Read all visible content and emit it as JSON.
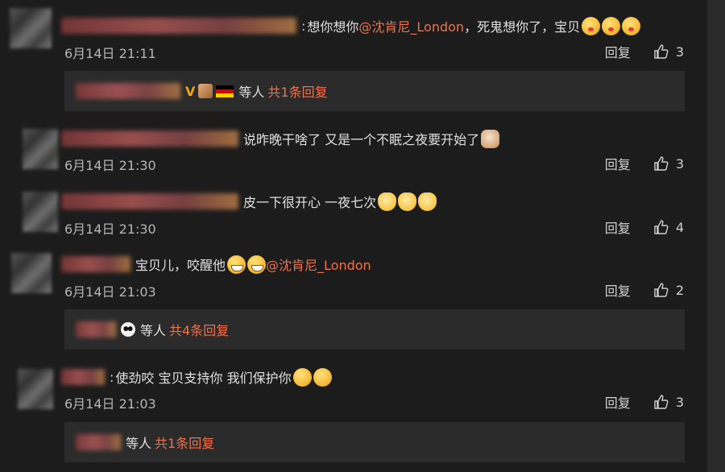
{
  "comments": [
    {
      "text_before": "想你想你",
      "mention": "@沈肯尼_London",
      "text_after": "，死鬼想你了，宝贝",
      "emojis": [
        "kiss-face",
        "kiss-face",
        "kiss-face"
      ],
      "time": "6月14日 21:11",
      "reply_label": "回复",
      "like_count": "3",
      "sub_reply": {
        "suffix": "等人",
        "more": "共1条回复"
      }
    },
    {
      "text": "说昨晚干啥了 又是一个不眠之夜要开始了",
      "emojis": [
        "dog-face"
      ],
      "time": "6月14日 21:30",
      "reply_label": "回复",
      "like_count": "3"
    },
    {
      "text": "皮一下很开心 一夜七次",
      "emojis": [
        "cat-face",
        "cat-face",
        "cat-face"
      ],
      "time": "6月14日 21:30",
      "reply_label": "回复",
      "like_count": "4"
    },
    {
      "text": "宝贝儿，咬醒他",
      "emojis": [
        "grin-face",
        "grin-face"
      ],
      "mention": "@沈肯尼_London",
      "time": "6月14日 21:03",
      "reply_label": "回复",
      "like_count": "2",
      "sub_reply": {
        "suffix": "等人",
        "more": "共4条回复"
      }
    },
    {
      "text": "使劲咬 宝贝支持你 我们保护你",
      "emojis": [
        "drool-face",
        "drool-face"
      ],
      "time": "6月14日 21:03",
      "reply_label": "回复",
      "like_count": "3",
      "sub_reply": {
        "suffix": "等人",
        "more": "共1条回复"
      }
    }
  ]
}
